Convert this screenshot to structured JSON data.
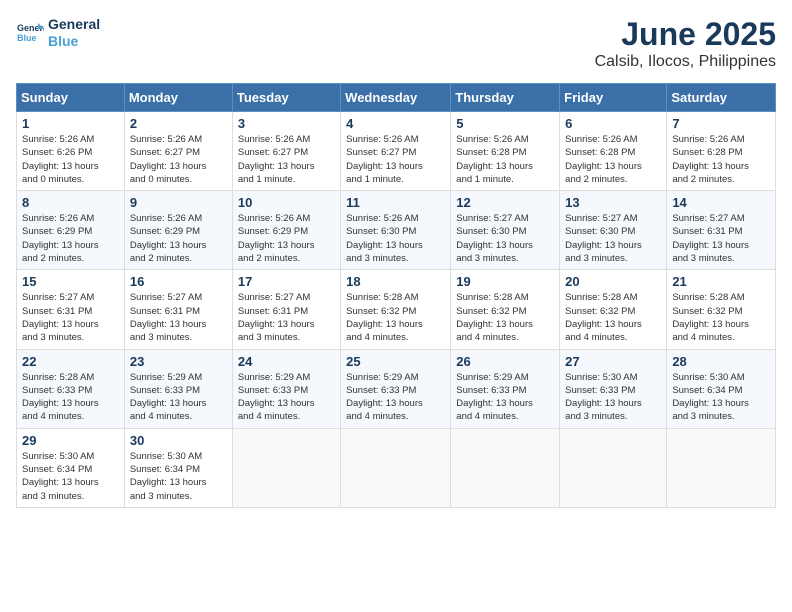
{
  "header": {
    "logo_line1": "General",
    "logo_line2": "Blue",
    "title": "June 2025",
    "subtitle": "Calsib, Ilocos, Philippines"
  },
  "weekdays": [
    "Sunday",
    "Monday",
    "Tuesday",
    "Wednesday",
    "Thursday",
    "Friday",
    "Saturday"
  ],
  "weeks": [
    [
      {
        "day": "1",
        "info": "Sunrise: 5:26 AM\nSunset: 6:26 PM\nDaylight: 13 hours\nand 0 minutes."
      },
      {
        "day": "2",
        "info": "Sunrise: 5:26 AM\nSunset: 6:27 PM\nDaylight: 13 hours\nand 0 minutes."
      },
      {
        "day": "3",
        "info": "Sunrise: 5:26 AM\nSunset: 6:27 PM\nDaylight: 13 hours\nand 1 minute."
      },
      {
        "day": "4",
        "info": "Sunrise: 5:26 AM\nSunset: 6:27 PM\nDaylight: 13 hours\nand 1 minute."
      },
      {
        "day": "5",
        "info": "Sunrise: 5:26 AM\nSunset: 6:28 PM\nDaylight: 13 hours\nand 1 minute."
      },
      {
        "day": "6",
        "info": "Sunrise: 5:26 AM\nSunset: 6:28 PM\nDaylight: 13 hours\nand 2 minutes."
      },
      {
        "day": "7",
        "info": "Sunrise: 5:26 AM\nSunset: 6:28 PM\nDaylight: 13 hours\nand 2 minutes."
      }
    ],
    [
      {
        "day": "8",
        "info": "Sunrise: 5:26 AM\nSunset: 6:29 PM\nDaylight: 13 hours\nand 2 minutes."
      },
      {
        "day": "9",
        "info": "Sunrise: 5:26 AM\nSunset: 6:29 PM\nDaylight: 13 hours\nand 2 minutes."
      },
      {
        "day": "10",
        "info": "Sunrise: 5:26 AM\nSunset: 6:29 PM\nDaylight: 13 hours\nand 2 minutes."
      },
      {
        "day": "11",
        "info": "Sunrise: 5:26 AM\nSunset: 6:30 PM\nDaylight: 13 hours\nand 3 minutes."
      },
      {
        "day": "12",
        "info": "Sunrise: 5:27 AM\nSunset: 6:30 PM\nDaylight: 13 hours\nand 3 minutes."
      },
      {
        "day": "13",
        "info": "Sunrise: 5:27 AM\nSunset: 6:30 PM\nDaylight: 13 hours\nand 3 minutes."
      },
      {
        "day": "14",
        "info": "Sunrise: 5:27 AM\nSunset: 6:31 PM\nDaylight: 13 hours\nand 3 minutes."
      }
    ],
    [
      {
        "day": "15",
        "info": "Sunrise: 5:27 AM\nSunset: 6:31 PM\nDaylight: 13 hours\nand 3 minutes."
      },
      {
        "day": "16",
        "info": "Sunrise: 5:27 AM\nSunset: 6:31 PM\nDaylight: 13 hours\nand 3 minutes."
      },
      {
        "day": "17",
        "info": "Sunrise: 5:27 AM\nSunset: 6:31 PM\nDaylight: 13 hours\nand 3 minutes."
      },
      {
        "day": "18",
        "info": "Sunrise: 5:28 AM\nSunset: 6:32 PM\nDaylight: 13 hours\nand 4 minutes."
      },
      {
        "day": "19",
        "info": "Sunrise: 5:28 AM\nSunset: 6:32 PM\nDaylight: 13 hours\nand 4 minutes."
      },
      {
        "day": "20",
        "info": "Sunrise: 5:28 AM\nSunset: 6:32 PM\nDaylight: 13 hours\nand 4 minutes."
      },
      {
        "day": "21",
        "info": "Sunrise: 5:28 AM\nSunset: 6:32 PM\nDaylight: 13 hours\nand 4 minutes."
      }
    ],
    [
      {
        "day": "22",
        "info": "Sunrise: 5:28 AM\nSunset: 6:33 PM\nDaylight: 13 hours\nand 4 minutes."
      },
      {
        "day": "23",
        "info": "Sunrise: 5:29 AM\nSunset: 6:33 PM\nDaylight: 13 hours\nand 4 minutes."
      },
      {
        "day": "24",
        "info": "Sunrise: 5:29 AM\nSunset: 6:33 PM\nDaylight: 13 hours\nand 4 minutes."
      },
      {
        "day": "25",
        "info": "Sunrise: 5:29 AM\nSunset: 6:33 PM\nDaylight: 13 hours\nand 4 minutes."
      },
      {
        "day": "26",
        "info": "Sunrise: 5:29 AM\nSunset: 6:33 PM\nDaylight: 13 hours\nand 4 minutes."
      },
      {
        "day": "27",
        "info": "Sunrise: 5:30 AM\nSunset: 6:33 PM\nDaylight: 13 hours\nand 3 minutes."
      },
      {
        "day": "28",
        "info": "Sunrise: 5:30 AM\nSunset: 6:34 PM\nDaylight: 13 hours\nand 3 minutes."
      }
    ],
    [
      {
        "day": "29",
        "info": "Sunrise: 5:30 AM\nSunset: 6:34 PM\nDaylight: 13 hours\nand 3 minutes."
      },
      {
        "day": "30",
        "info": "Sunrise: 5:30 AM\nSunset: 6:34 PM\nDaylight: 13 hours\nand 3 minutes."
      },
      {
        "day": "",
        "info": ""
      },
      {
        "day": "",
        "info": ""
      },
      {
        "day": "",
        "info": ""
      },
      {
        "day": "",
        "info": ""
      },
      {
        "day": "",
        "info": ""
      }
    ]
  ]
}
